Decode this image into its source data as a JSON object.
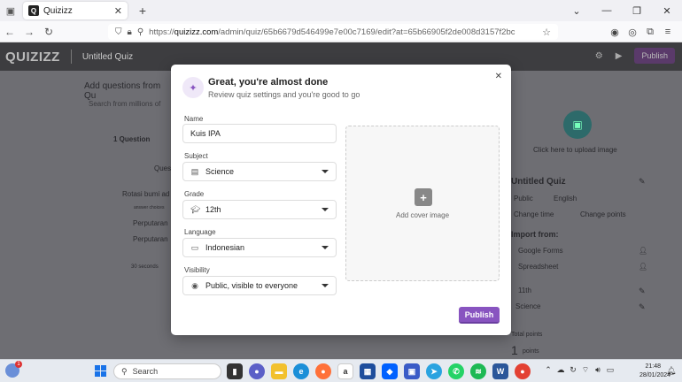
{
  "browser": {
    "tab_title": "Quizizz",
    "tab_favicon": "Q",
    "url_scheme": "https://",
    "url_host": "quizizz.com",
    "url_path": "/admin/quiz/65b6679d546499e7e00c7169/edit?at=65b66905f2de008d3157f2bc"
  },
  "app": {
    "logo": "QUIZIZZ",
    "quiz_name": "Untitled Quiz",
    "header_publish": "Publish",
    "background_left": {
      "add_questions": "Add questions from Qu",
      "search_placeholder": "Search from millions of",
      "question_count": "1 Question",
      "question_prefix": "Ques",
      "question_text": "Rotasi bumi ad",
      "answer_choices": "answer choices",
      "option1": "Perputaran",
      "option2": "Perputaran",
      "seconds": "30 seconds"
    },
    "background_right": {
      "upload_image": "Click here to upload image",
      "quiz_title": "Untitled Quiz",
      "visibility": "Public",
      "language": "English",
      "change_time": "Change time",
      "change_points": "Change points",
      "import_from": "Import from:",
      "google_forms": "Google Forms",
      "spreadsheet": "Spreadsheet",
      "grade": "11th",
      "subject": "Science",
      "total_points": "Total points",
      "points_value": "1",
      "points_label": "points"
    }
  },
  "modal": {
    "title": "Great, you're almost done",
    "subtitle": "Review quiz settings and you're good to go",
    "name_label": "Name",
    "name_value": "Kuis IPA",
    "subject_label": "Subject",
    "subject_value": "Science",
    "grade_label": "Grade",
    "grade_value": "12th",
    "language_label": "Language",
    "language_value": "Indonesian",
    "visibility_label": "Visibility",
    "visibility_value": "Public, visible to everyone",
    "cover_label": "Add cover image",
    "publish_label": "Publish",
    "accent_color": "#8854c0"
  },
  "taskbar": {
    "search_label": "Search",
    "weather_badge": "1",
    "time": "21:48",
    "date": "28/01/2024"
  }
}
